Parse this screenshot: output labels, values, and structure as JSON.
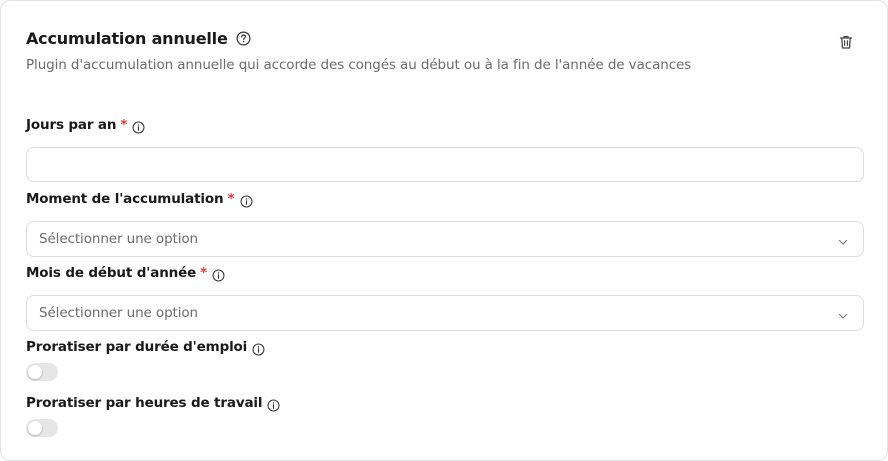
{
  "header": {
    "title": "Accumulation annuelle",
    "subtitle": "Plugin d'accumulation annuelle qui accorde des congés au début ou à la fin de l'année de vacances"
  },
  "fields": {
    "days_per_year": {
      "label": "Jours par an",
      "required_mark": "*",
      "value": ""
    },
    "accrual_timing": {
      "label": "Moment de l'accumulation",
      "required_mark": "*",
      "placeholder": "Sélectionner une option"
    },
    "year_start_month": {
      "label": "Mois de début d'année",
      "required_mark": "*",
      "placeholder": "Sélectionner une option"
    },
    "prorate_employment": {
      "label": "Proratiser par durée d'emploi",
      "enabled": false
    },
    "prorate_work_hours": {
      "label": "Proratiser par heures de travail",
      "enabled": false
    }
  },
  "icons": {
    "help": "help-circle-icon",
    "info": "info-circle-icon",
    "delete": "trash-icon",
    "chevron": "chevron-down-icon"
  },
  "colors": {
    "required": "#e53935",
    "border": "#dcdcdc",
    "toggle_off": "#e6e6e6"
  }
}
